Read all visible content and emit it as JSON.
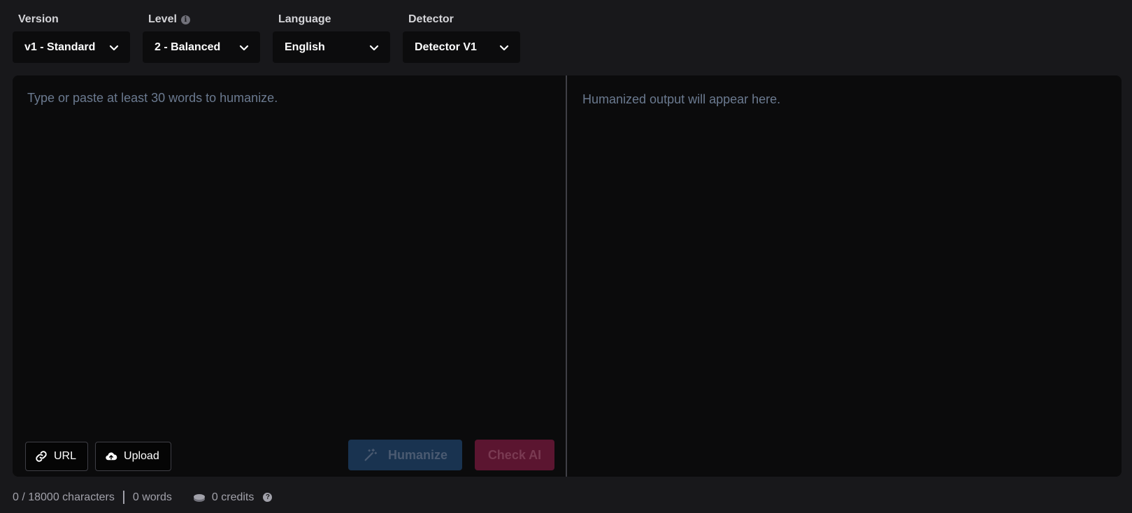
{
  "controls": {
    "version": {
      "label": "Version",
      "value": "v1 - Standard"
    },
    "level": {
      "label": "Level",
      "value": "2 - Balanced",
      "info_icon": "i"
    },
    "language": {
      "label": "Language",
      "value": "English"
    },
    "detector": {
      "label": "Detector",
      "value": "Detector V1"
    }
  },
  "input": {
    "placeholder": "Type or paste at least 30 words to humanize.",
    "value": ""
  },
  "output": {
    "placeholder": "Humanized output will appear here."
  },
  "buttons": {
    "url": "URL",
    "upload": "Upload",
    "humanize": "Humanize",
    "check_ai": "Check AI"
  },
  "footer": {
    "characters": "0 / 18000 characters",
    "words": "0 words",
    "credits": "0 credits",
    "help_icon": "?"
  },
  "colors": {
    "background": "#18181b",
    "panel": "#0b0b0c",
    "humanize_button": "#193350",
    "check_ai_button": "#5b1530",
    "placeholder_text": "#6b7a90"
  }
}
